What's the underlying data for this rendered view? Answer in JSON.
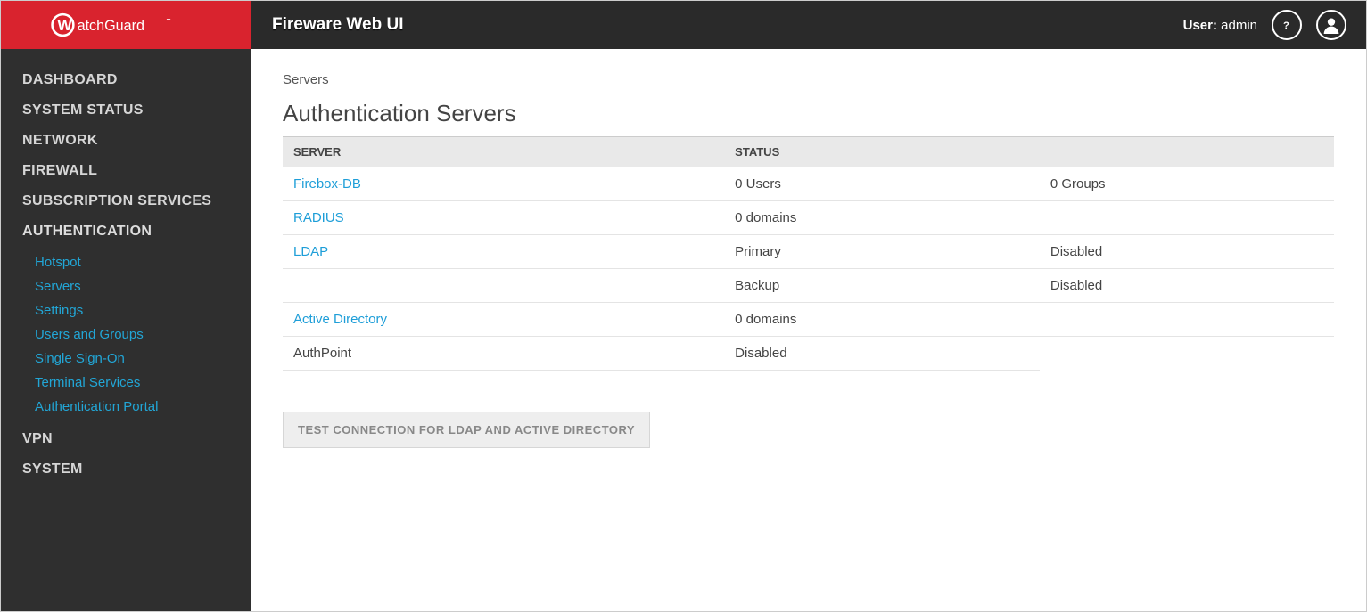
{
  "header": {
    "app_title": "Fireware Web UI",
    "user_label": "User:",
    "user_name": "admin"
  },
  "sidebar": {
    "items": [
      {
        "label": "DASHBOARD"
      },
      {
        "label": "SYSTEM STATUS"
      },
      {
        "label": "NETWORK"
      },
      {
        "label": "FIREWALL"
      },
      {
        "label": "SUBSCRIPTION SERVICES"
      },
      {
        "label": "AUTHENTICATION",
        "expanded": true,
        "children": [
          {
            "label": "Hotspot"
          },
          {
            "label": "Servers"
          },
          {
            "label": "Settings"
          },
          {
            "label": "Users and Groups"
          },
          {
            "label": "Single Sign-On"
          },
          {
            "label": "Terminal Services"
          },
          {
            "label": "Authentication Portal"
          }
        ]
      },
      {
        "label": "VPN"
      },
      {
        "label": "SYSTEM"
      }
    ]
  },
  "main": {
    "breadcrumb": "Servers",
    "page_title": "Authentication Servers",
    "columns": {
      "server": "SERVER",
      "status": "STATUS"
    },
    "rows": [
      {
        "server": "Firebox-DB",
        "link": true,
        "status1": "0 Users",
        "status2": "0 Groups"
      },
      {
        "server": "RADIUS",
        "link": true,
        "status1": "0 domains",
        "status2": ""
      },
      {
        "server": "LDAP",
        "link": true,
        "status1": "Primary",
        "status2": "Disabled"
      },
      {
        "server": "",
        "link": false,
        "status1": "Backup",
        "status2": "Disabled"
      },
      {
        "server": "Active Directory",
        "link": true,
        "status1": "0 domains",
        "status2": ""
      },
      {
        "server": "AuthPoint",
        "link": false,
        "status1": "Disabled",
        "status2": "",
        "short": true
      }
    ],
    "test_button": "TEST CONNECTION FOR LDAP AND ACTIVE DIRECTORY"
  }
}
